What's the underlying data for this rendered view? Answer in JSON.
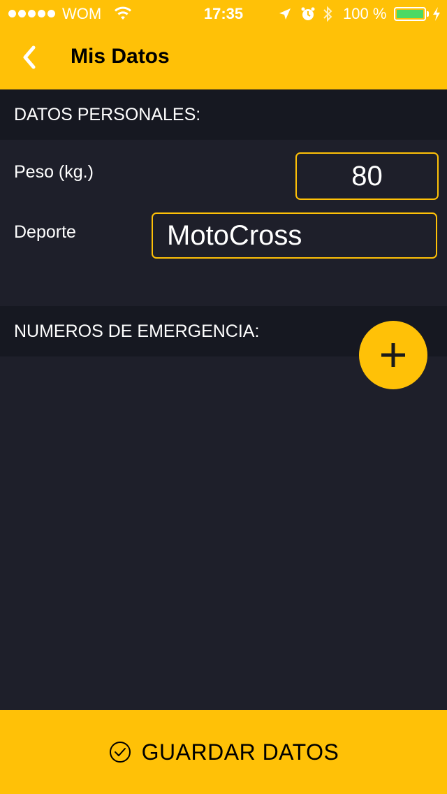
{
  "status_bar": {
    "carrier": "WOM",
    "time": "17:35",
    "battery_percent": "100 %",
    "signal_dots": 5,
    "battery_level": 1.0
  },
  "nav": {
    "title": "Mis Datos",
    "back_icon": "chevron-left-icon"
  },
  "personal": {
    "header": "DATOS PERSONALES:",
    "peso_label": "Peso (kg.)",
    "peso_value": "80",
    "deporte_label": "Deporte",
    "deporte_value": "MotoCross"
  },
  "emergency": {
    "header": "NUMEROS DE EMERGENCIA:",
    "add_icon": "plus-icon"
  },
  "footer": {
    "save_label": "GUARDAR DATOS",
    "save_icon": "check-circle-icon"
  },
  "colors": {
    "accent": "#ffc107",
    "background": "#1e1f2a",
    "section_header": "#161821",
    "battery_fill": "#4cd964"
  }
}
